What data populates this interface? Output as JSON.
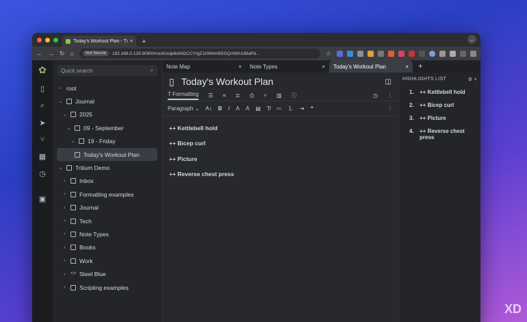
{
  "browser": {
    "tab_title": "Today's Workout Plan - Trilium",
    "new_tab": "+",
    "not_secure": "Not Secure",
    "url": "192.168.0.133:9090/#root/Uoip6dX62CCY/gZJzWhim8SGQ/AWUcBlaPd..."
  },
  "tree": {
    "search_placeholder": "Quick search",
    "nodes": [
      {
        "label": "root"
      },
      {
        "label": "Journal"
      },
      {
        "label": "2025"
      },
      {
        "label": "09 - September"
      },
      {
        "label": "19 - Friday"
      },
      {
        "label": "Today's Workout Plan"
      },
      {
        "label": "Trilium Demo"
      },
      {
        "label": "Inbox"
      },
      {
        "label": "Formatting examples"
      },
      {
        "label": "Journal"
      },
      {
        "label": "Tech"
      },
      {
        "label": "Note Types"
      },
      {
        "label": "Books"
      },
      {
        "label": "Work"
      },
      {
        "label": "Steel Blue"
      },
      {
        "label": "Scripting examples"
      }
    ]
  },
  "tabs": [
    {
      "label": "Note Map"
    },
    {
      "label": "Note Types"
    },
    {
      "label": "Today's Workout Plan"
    }
  ],
  "note": {
    "title": "Today's Workout Plan",
    "ribbon_formatting": "Formatting",
    "paragraph_select": "Paragraph",
    "lines": [
      "++ Kettlebell hold",
      "++ Bicep curl",
      "++ Picture",
      "++ Reverse chest press"
    ]
  },
  "highlights": {
    "title": "HIGHLIGHTS LIST",
    "items": [
      {
        "n": "1.",
        "text": "++ Kettlebell hold"
      },
      {
        "n": "2.",
        "text": "++ Bicep curl"
      },
      {
        "n": "3.",
        "text": "++ Picture"
      },
      {
        "n": "4.",
        "text": "++ Reverse chest press"
      }
    ]
  },
  "watermark": "XD"
}
